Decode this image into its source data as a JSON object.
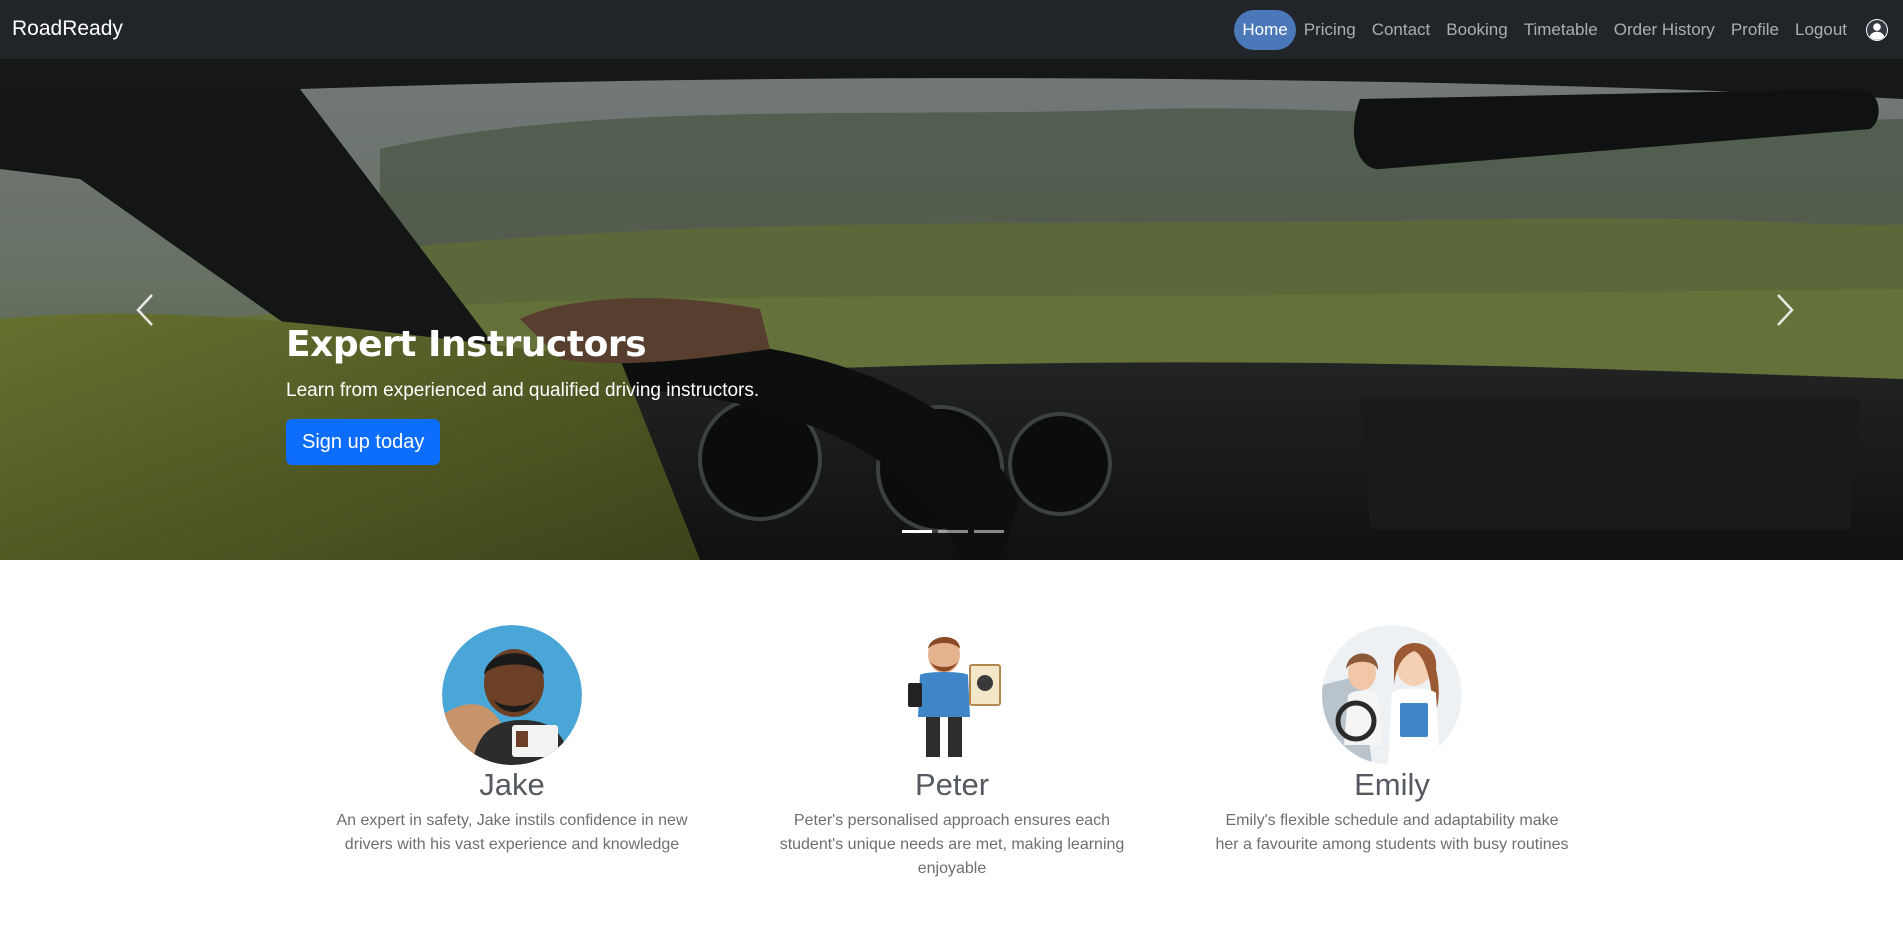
{
  "brand": "RoadReady",
  "nav": {
    "items": [
      "Home",
      "Pricing",
      "Contact",
      "Booking",
      "Timetable",
      "Order History",
      "Profile",
      "Logout"
    ],
    "active": "Home",
    "profile_icon": "person-circle-icon"
  },
  "carousel": {
    "title": "Expert Instructors",
    "subtitle": "Learn from experienced and qualified driving instructors.",
    "button": "Sign up today",
    "slide_count": 3,
    "active_slide": 1,
    "prev_icon": "chevron-left-icon",
    "next_icon": "chevron-right-icon"
  },
  "instructors": [
    {
      "name": "Jake",
      "description": "An expert in safety, Jake instils confidence in new drivers with his vast experience and knowledge"
    },
    {
      "name": "Peter",
      "description": "Peter's personalised approach ensures each student's unique needs are met, making learning enjoyable"
    },
    {
      "name": "Emily",
      "description": "Emily's flexible schedule and adaptability make her a favourite among students with busy routines"
    }
  ],
  "colors": {
    "navbar_bg": "#212529",
    "active_pill": "#4a78b8",
    "primary_button": "#0d6efd"
  }
}
